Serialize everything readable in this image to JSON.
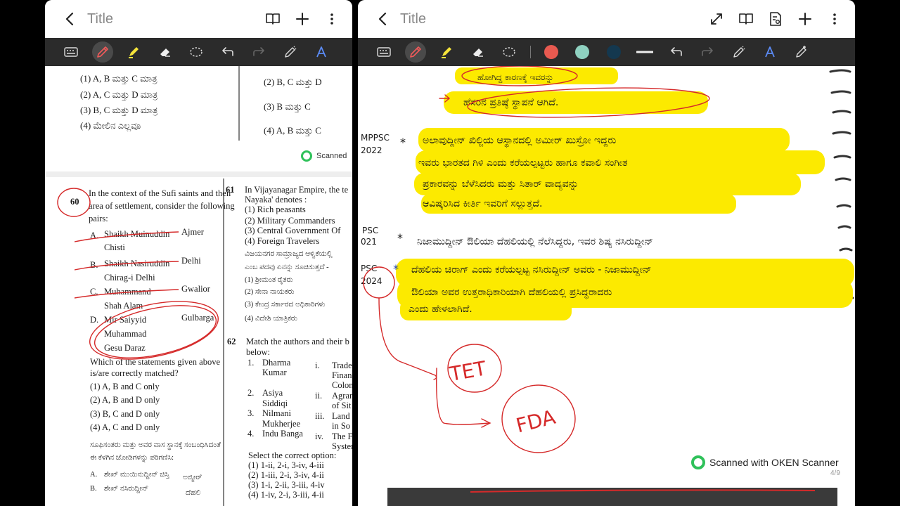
{
  "left_pane": {
    "title": "Title",
    "doc": {
      "q59_options_left": [
        "(1)  A, B ಮತ್ತು C ಮಾತ್ರ",
        "(2)  A, C ಮತ್ತು D ಮಾತ್ರ",
        "(3)  B, C ಮತ್ತು D ಮಾತ್ರ",
        "(4)  ಮೇಲಿನ ಎಲ್ಲವೂ"
      ],
      "q59_options_right": [
        "(2)  B, C ಮತ್ತು D",
        "(3)  B ಮತ್ತು C",
        "(4)  A, B ಮತ್ತು C"
      ],
      "scanned_label": "Scanned",
      "q60": {
        "number": "60",
        "stem": [
          "In the context of the Sufi saints and their",
          "area of settlement, consider the following",
          "pairs:"
        ],
        "pairs": [
          {
            "letter": "A.",
            "name": [
              "Shaikh Muinuddin",
              "Chisti"
            ],
            "place": "Ajmer"
          },
          {
            "letter": "B.",
            "name": [
              "Shaikh Nasiruddin",
              "Chirag-i Delhi"
            ],
            "place": "Delhi"
          },
          {
            "letter": "C.",
            "name": [
              "Muhammand",
              "Shah Alam"
            ],
            "place": "Gwalior"
          },
          {
            "letter": "D.",
            "name": [
              "Mir Saiyyid",
              "Muhammad",
              "Gesu Daraz"
            ],
            "place": "Gulbarga"
          }
        ],
        "question": [
          "Which of the statements given above",
          "is/are correctly matched?"
        ],
        "options": [
          "(1)   A, B and C only",
          "(2)   A, B and D only",
          "(3)   B, C and D only",
          "(4)   A, C and D only"
        ],
        "kannada": [
          "ಸೂಫಿಸಂತರು ಮತ್ತು ಅವರ ವಾಸ ಸ್ಥಾನಕ್ಕೆ ಸಂಬಂಧಿಸಿದಂತೆ",
          "ಈ ಕೆಳಗಿನ ಜೋಡಿಗಳನ್ನು ಪರಿಗಣಿಸಿ:"
        ],
        "kannada_pairs": [
          {
            "letter": "A.",
            "name": "ಶೇಖ್ ಮುಯಿನುದ್ದೀನ್ ಚಿಸ್ತಿ",
            "place": "ಅಜ್ಮೀರ್"
          },
          {
            "letter": "B.",
            "name": "ಶೇಖ್ ನಸಿರುದ್ದೀನ್",
            "place": "ದೆಹಲಿ"
          }
        ]
      },
      "q61": {
        "number": "61",
        "stem": [
          "In Vijayanagar Empire, the te",
          "Nayaka' denotes :"
        ],
        "options": [
          "(1)  Rich peasants",
          "(2)  Military Commanders",
          "(3)  Central Government Of",
          "(4)  Foreign Travelers"
        ],
        "kannada": [
          "ವಿಜಯನಗರ ಸಾಮ್ರಾಜ್ಯದ ಆಳ್ವಿಕೆಯಲ್ಲಿ",
          "ಎಂಬ ಪದವು ಏನನ್ನು ಸೂಚಿಸುತ್ತದೆ -"
        ],
        "kannada_options": [
          "(1)  ಶ್ರೀಮಂತ ರೈತರು",
          "(2)  ಸೇನಾ ನಾಯಕರು",
          "(3)  ಕೇಂದ್ರ ಸರ್ಕಾರದ ಅಧಿಕಾರಿಗಳು",
          "(4)  ವಿದೇಶಿ ಯಾತ್ರಿಕರು"
        ]
      },
      "q62": {
        "number": "62",
        "stem": [
          "Match the authors and their b",
          "below:"
        ],
        "authors": [
          {
            "num": "1.",
            "name": [
              "Dharma",
              "Kumar"
            ],
            "roman": "i.",
            "work": [
              "Trade",
              "Finan",
              "Colon"
            ]
          },
          {
            "num": "2.",
            "name": [
              "Asiya",
              "Siddiqi"
            ],
            "roman": "ii.",
            "work": [
              "Agrar",
              "of Sit"
            ]
          },
          {
            "num": "3.",
            "name": [
              "Nilmani",
              "Mukherjee"
            ],
            "roman": "iii.",
            "work": [
              "Land",
              "in So"
            ]
          },
          {
            "num": "4.",
            "name": [
              "Indu Banga"
            ],
            "roman": "iv.",
            "work": [
              "The F",
              "Syster"
            ]
          }
        ],
        "select": "Select the correct option:",
        "options": [
          "(1)   1-ii, 2-i, 3-iv, 4-iii",
          "(2)   1-iii, 2-i, 3-iv, 4-ii",
          "(3)   1-i, 2-ii, 3-iii, 4-iv",
          "(4)   1-iv, 2-i, 3-iii, 4-ii"
        ]
      }
    }
  },
  "right_pane": {
    "title": "Title",
    "colors": {
      "red": "#e85a50",
      "teal": "#8fd1c0",
      "navy": "#14384f",
      "highlight": "#fcea00",
      "ink": "#1a1a1a",
      "annot": "#d52a2a"
    },
    "doc": {
      "top_fragment": "ಹೋಗಿದ್ದ ಕಾರಣಕ್ಕೆ ಇವರನ್ನು",
      "top_line": "ಹೆಸರಿನ ಪ್ರತಿಷ್ಠೆ ಸ್ಥಾಪನೆ ಆಗಿದೆ.",
      "margin_1": [
        "MPPSC",
        "2022"
      ],
      "para_1": [
        "ಅಲಾವುದ್ದೀನ್ ಖಿಲ್ಜಿಯ ಆಸ್ಥಾನದಲ್ಲಿ ಅಮೀರ್ ಖುಸ್ರೋ ಇದ್ದರು",
        "ಇವರು ಭಾರತದ ಗಿಳಿ ಎಂದು ಕರೆಯಲ್ಪಟ್ಟರು ಹಾಗೂ ಕವಾಲಿ ಸಂಗೀತ",
        "ಪ್ರಕಾರವನ್ನು ಬೆಳೆಸಿದರು ಮತ್ತು ಸಿತಾರ್ ವಾದ್ಯವನ್ನು",
        "ಆವಿಷ್ಕರಿಸಿದ ಕೀರ್ತಿ ಇವರಿಗೆ ಸಲ್ಲುತ್ತದೆ."
      ],
      "margin_2": [
        "PSC",
        "021"
      ],
      "line_2": "ನಿಜಾಮುದ್ದೀನ್ ಔಲಿಯಾ ದೆಹಲಿಯಲ್ಲಿ ನೆಲೆಸಿದ್ದರು, ಇವರ ಶಿಷ್ಯ ನಸಿರುದ್ದೀನ್",
      "margin_3": [
        "PSC",
        "2024"
      ],
      "para_3": [
        "ದೆಹಲಿಯ ಚಿರಾಗ್ ಎಂದು ಕರೆಯಲ್ಪಟ್ಟ ನಸಿರುದ್ದೀನ್ ಅವರು - ನಿಜಾಮುದ್ದೀನ್",
        "ಔಲಿಯಾ ಅವರ ಉತ್ತರಾಧಿಕಾರಿಯಾಗಿ ದೆಹಲಿಯಲ್ಲಿ ಪ್ರಸಿದ್ಧರಾದರು",
        "ಎಂದು ಹೇಳಲಾಗಿದೆ."
      ],
      "tet_label": "TET",
      "fda_label": "FDA",
      "scanned_label": "Scanned with OKEN Scanner",
      "page_num": "4/9"
    }
  }
}
